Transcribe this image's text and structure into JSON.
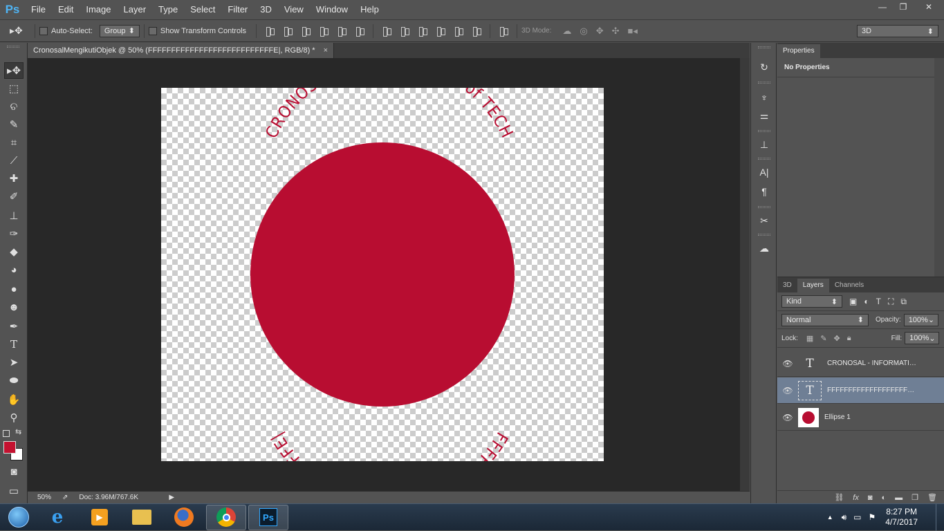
{
  "app": {
    "logo": "Ps"
  },
  "menu": [
    "File",
    "Edit",
    "Image",
    "Layer",
    "Type",
    "Select",
    "Filter",
    "3D",
    "View",
    "Window",
    "Help"
  ],
  "window_controls": {
    "minimize": "—",
    "restore": "❐",
    "close": "✕"
  },
  "options": {
    "auto_select_label": "Auto-Select:",
    "auto_select_value": "Group",
    "transform_label": "Show Transform Controls",
    "mode_3d_label": "3D Mode:",
    "workspace_value": "3D"
  },
  "document": {
    "tab_title": "CronosalMengikutiObjek @ 50% (FFFFFFFFFFFFFFFFFFFFFFFFFFFE|, RGB/8) *",
    "tab_close": "×",
    "top_text": "CRONOSAL - INFORMATION of TECH",
    "bottom_text": "FFFFFFFFFFFFFFFFFFFFFFFFFFFE|",
    "circle_color": "#b80d31"
  },
  "status": {
    "zoom": "50%",
    "doc": "Doc: 3.96M/767.6K"
  },
  "colors": {
    "foreground": "#c41230",
    "background": "#ffffff"
  },
  "properties": {
    "tab": "Properties",
    "message": "No Properties"
  },
  "layers_panel": {
    "tabs": [
      "3D",
      "Layers",
      "Channels"
    ],
    "filter_value": "Kind",
    "blend_mode": "Normal",
    "opacity_label": "Opacity:",
    "opacity_value": "100%",
    "lock_label": "Lock:",
    "fill_label": "Fill:",
    "fill_value": "100%",
    "layers": [
      {
        "name": "CRONOSAL - INFORMATIO...",
        "type": "text"
      },
      {
        "name": "FFFFFFFFFFFFFFFFFFFFFFF...",
        "type": "text"
      },
      {
        "name": "Ellipse 1",
        "type": "shape"
      }
    ]
  },
  "taskbar": {
    "time": "8:27 PM",
    "date": "4/7/2017"
  }
}
